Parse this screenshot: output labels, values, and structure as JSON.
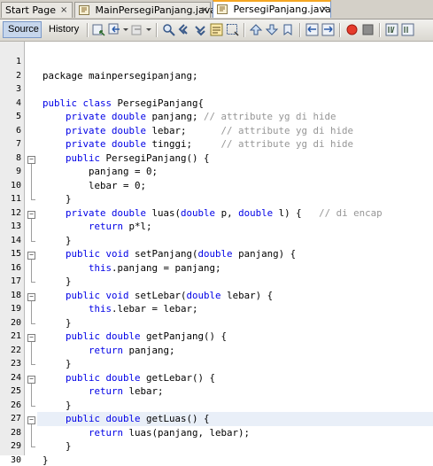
{
  "tabs": [
    {
      "label": "Start Page",
      "active": false
    },
    {
      "label": "MainPersegiPanjang.java",
      "active": false
    },
    {
      "label": "PersegiPanjang.java",
      "active": true
    }
  ],
  "close_glyph": "×",
  "toolbar": {
    "source_label": "Source",
    "history_label": "History"
  },
  "colors": {
    "keyword": "#0000e6",
    "comment": "#969696",
    "current_line": "#e9eff8",
    "tab_accent": "#f5a623"
  },
  "editor": {
    "current_line": 27,
    "lines": [
      {
        "n": "1",
        "segs": []
      },
      {
        "n": "2",
        "segs": [
          {
            "t": "package mainpersegipanjang;"
          }
        ]
      },
      {
        "n": "3",
        "segs": []
      },
      {
        "n": "4",
        "segs": [
          {
            "t": "public class ",
            "k": "kw"
          },
          {
            "t": "PersegiPanjang{"
          }
        ]
      },
      {
        "n": "5",
        "segs": [
          {
            "t": "    "
          },
          {
            "t": "private double ",
            "k": "kw"
          },
          {
            "t": "panjang; "
          },
          {
            "t": "// attribute yg di hide",
            "k": "cm"
          }
        ]
      },
      {
        "n": "6",
        "segs": [
          {
            "t": "    "
          },
          {
            "t": "private double ",
            "k": "kw"
          },
          {
            "t": "lebar;      "
          },
          {
            "t": "// attribute yg di hide",
            "k": "cm"
          }
        ]
      },
      {
        "n": "7",
        "segs": [
          {
            "t": "    "
          },
          {
            "t": "private double ",
            "k": "kw"
          },
          {
            "t": "tinggi;     "
          },
          {
            "t": "// attribute yg di hide",
            "k": "cm"
          }
        ]
      },
      {
        "n": "8",
        "segs": [
          {
            "t": "    "
          },
          {
            "t": "public ",
            "k": "kw"
          },
          {
            "t": "PersegiPanjang() {"
          }
        ]
      },
      {
        "n": "9",
        "segs": [
          {
            "t": "        panjang = 0;"
          }
        ]
      },
      {
        "n": "10",
        "segs": [
          {
            "t": "        lebar = 0;"
          }
        ]
      },
      {
        "n": "11",
        "segs": [
          {
            "t": "    }"
          }
        ]
      },
      {
        "n": "12",
        "segs": [
          {
            "t": "    "
          },
          {
            "t": "private double ",
            "k": "kw"
          },
          {
            "t": "luas("
          },
          {
            "t": "double ",
            "k": "kw"
          },
          {
            "t": "p, "
          },
          {
            "t": "double ",
            "k": "kw"
          },
          {
            "t": "l) {   "
          },
          {
            "t": "// di encap",
            "k": "cm"
          }
        ]
      },
      {
        "n": "13",
        "segs": [
          {
            "t": "        "
          },
          {
            "t": "return ",
            "k": "kw"
          },
          {
            "t": "p*l;"
          }
        ]
      },
      {
        "n": "14",
        "segs": [
          {
            "t": "    }"
          }
        ]
      },
      {
        "n": "15",
        "segs": [
          {
            "t": "    "
          },
          {
            "t": "public void ",
            "k": "kw"
          },
          {
            "t": "setPanjang("
          },
          {
            "t": "double ",
            "k": "kw"
          },
          {
            "t": "panjang) {"
          }
        ]
      },
      {
        "n": "16",
        "segs": [
          {
            "t": "        "
          },
          {
            "t": "this",
            "k": "kw"
          },
          {
            "t": ".panjang = panjang;"
          }
        ]
      },
      {
        "n": "17",
        "segs": [
          {
            "t": "    }"
          }
        ]
      },
      {
        "n": "18",
        "segs": [
          {
            "t": "    "
          },
          {
            "t": "public void ",
            "k": "kw"
          },
          {
            "t": "setLebar("
          },
          {
            "t": "double ",
            "k": "kw"
          },
          {
            "t": "lebar) {"
          }
        ]
      },
      {
        "n": "19",
        "segs": [
          {
            "t": "        "
          },
          {
            "t": "this",
            "k": "kw"
          },
          {
            "t": ".lebar = lebar;"
          }
        ]
      },
      {
        "n": "20",
        "segs": [
          {
            "t": "    }"
          }
        ]
      },
      {
        "n": "21",
        "segs": [
          {
            "t": "    "
          },
          {
            "t": "public double ",
            "k": "kw"
          },
          {
            "t": "getPanjang() {"
          }
        ]
      },
      {
        "n": "22",
        "segs": [
          {
            "t": "        "
          },
          {
            "t": "return ",
            "k": "kw"
          },
          {
            "t": "panjang;"
          }
        ]
      },
      {
        "n": "23",
        "segs": [
          {
            "t": "    }"
          }
        ]
      },
      {
        "n": "24",
        "segs": [
          {
            "t": "    "
          },
          {
            "t": "public double ",
            "k": "kw"
          },
          {
            "t": "getLebar() {"
          }
        ]
      },
      {
        "n": "25",
        "segs": [
          {
            "t": "        "
          },
          {
            "t": "return ",
            "k": "kw"
          },
          {
            "t": "lebar;"
          }
        ]
      },
      {
        "n": "26",
        "segs": [
          {
            "t": "    }"
          }
        ]
      },
      {
        "n": "27",
        "segs": [
          {
            "t": "    "
          },
          {
            "t": "public double ",
            "k": "kw"
          },
          {
            "t": "getLuas() {"
          }
        ]
      },
      {
        "n": "28",
        "segs": [
          {
            "t": "        "
          },
          {
            "t": "return ",
            "k": "kw"
          },
          {
            "t": "luas(panjang, lebar);"
          }
        ]
      },
      {
        "n": "29",
        "segs": [
          {
            "t": "    }"
          }
        ]
      },
      {
        "n": "30",
        "segs": [
          {
            "t": "}"
          }
        ]
      }
    ],
    "folds": [
      {
        "start": 8,
        "end": 11
      },
      {
        "start": 12,
        "end": 14
      },
      {
        "start": 15,
        "end": 17
      },
      {
        "start": 18,
        "end": 20
      },
      {
        "start": 21,
        "end": 23
      },
      {
        "start": 24,
        "end": 26
      },
      {
        "start": 27,
        "end": 29
      }
    ]
  }
}
